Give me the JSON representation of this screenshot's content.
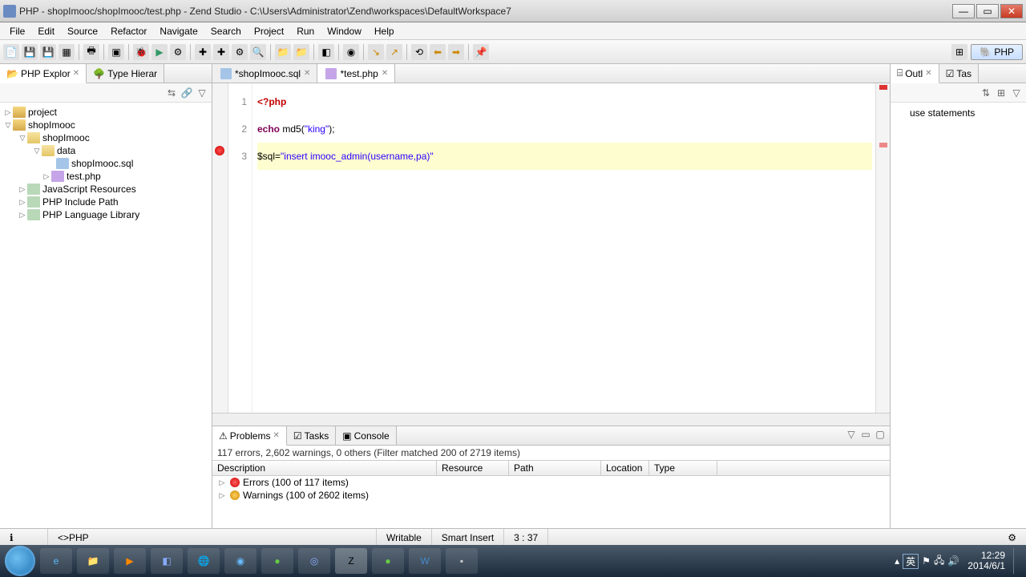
{
  "window": {
    "title": "PHP - shopImooc/shopImooc/test.php - Zend Studio - C:\\Users\\Administrator\\Zend\\workspaces\\DefaultWorkspace7"
  },
  "menu": {
    "items": [
      "File",
      "Edit",
      "Source",
      "Refactor",
      "Navigate",
      "Search",
      "Project",
      "Run",
      "Window",
      "Help"
    ]
  },
  "perspective": {
    "label": "PHP"
  },
  "left_views": {
    "explorer": "PHP Explor",
    "type_hier": "Type Hierar"
  },
  "tree": {
    "n0": "project",
    "n1": "shopImooc",
    "n2": "shopImooc",
    "n3": "data",
    "n4": "shopImooc.sql",
    "n5": "test.php",
    "n6": "JavaScript Resources",
    "n7": "PHP Include Path",
    "n8": "PHP Language Library"
  },
  "editor": {
    "tabs": [
      {
        "label": "*shopImooc.sql",
        "active": false
      },
      {
        "label": "*test.php",
        "active": true
      }
    ],
    "lines": {
      "l1": {
        "num": "1",
        "a": "<?php"
      },
      "l2": {
        "num": "2",
        "a": "echo",
        "b": " md5(",
        "c": "\"king\"",
        "d": ");"
      },
      "l3": {
        "num": "3",
        "a": "$sql=",
        "b": "\"insert imooc_admin(username,pa)\""
      }
    }
  },
  "right_views": {
    "outline": "Outl",
    "tasks": "Tas",
    "item": "use statements"
  },
  "problems": {
    "tabs": {
      "problems": "Problems",
      "tasks": "Tasks",
      "console": "Console"
    },
    "summary": "117 errors, 2,602 warnings, 0 others (Filter matched 200 of 2719 items)",
    "cols": {
      "c1": "Description",
      "c2": "Resource",
      "c3": "Path",
      "c4": "Location",
      "c5": "Type"
    },
    "rows": {
      "r1": "Errors (100 of 117 items)",
      "r2": "Warnings (100 of 2602 items)"
    }
  },
  "status": {
    "lang": "PHP",
    "writable": "Writable",
    "insert": "Smart Insert",
    "pos": "3 : 37"
  },
  "taskbar": {
    "time": "12:29",
    "date": "2014/6/1",
    "ime": "英"
  }
}
